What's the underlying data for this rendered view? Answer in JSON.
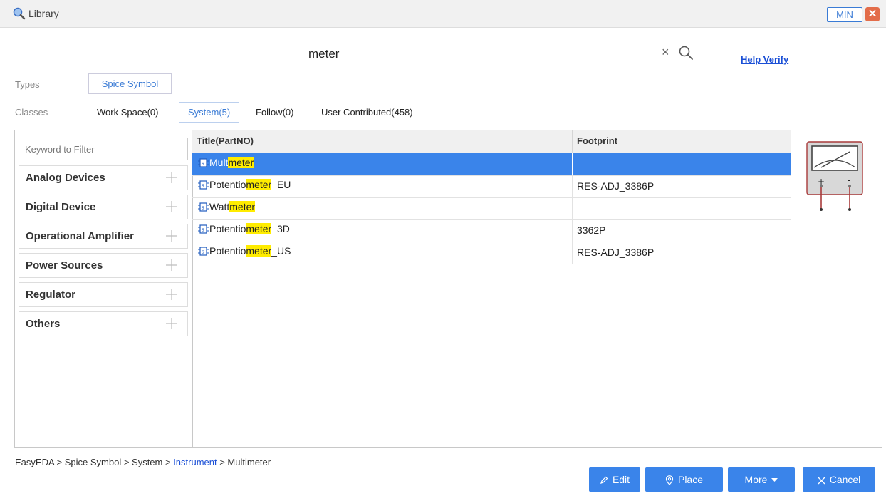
{
  "window": {
    "title": "Library",
    "min_label": "MIN",
    "close_label": "✕"
  },
  "search": {
    "value": "meter",
    "help_label": "Help Verify"
  },
  "types": {
    "label": "Types",
    "selected": "Spice Symbol"
  },
  "classes": {
    "label": "Classes",
    "items": [
      {
        "label": "Work Space(0)",
        "active": false
      },
      {
        "label": "System(5)",
        "active": true
      },
      {
        "label": "Follow(0)",
        "active": false
      },
      {
        "label": "User Contributed(458)",
        "active": false
      }
    ]
  },
  "sidebar": {
    "filter_placeholder": "Keyword to Filter",
    "categories": [
      "Analog Devices",
      "Digital Device",
      "Operational Amplifier",
      "Power Sources",
      "Regulator",
      "Others"
    ]
  },
  "table": {
    "columns": [
      "Title(PartNO)",
      "Footprint"
    ],
    "rows": [
      {
        "prefix": "Mult",
        "match": "meter",
        "suffix": "",
        "footprint": "",
        "selected": true
      },
      {
        "prefix": "Potentio",
        "match": "meter",
        "suffix": "_EU",
        "footprint": "RES-ADJ_3386P",
        "selected": false
      },
      {
        "prefix": "Watt",
        "match": "meter",
        "suffix": "",
        "footprint": "",
        "selected": false
      },
      {
        "prefix": "Potentio",
        "match": "meter",
        "suffix": "_3D",
        "footprint": "3362P",
        "selected": false
      },
      {
        "prefix": "Potentio",
        "match": "meter",
        "suffix": "_US",
        "footprint": "RES-ADJ_3386P",
        "selected": false
      }
    ]
  },
  "preview": {
    "plus_label": "+",
    "minus_label": "-"
  },
  "breadcrumb": {
    "part1": "EasyEDA > Spice Symbol > System > ",
    "link": "Instrument",
    "part2": " > Multimeter"
  },
  "actions": {
    "edit": "Edit",
    "place": "Place",
    "more": "More",
    "cancel": "Cancel"
  },
  "colors": {
    "accent": "#3a84ea",
    "highlight": "#ffec00",
    "close": "#e36d4a"
  }
}
